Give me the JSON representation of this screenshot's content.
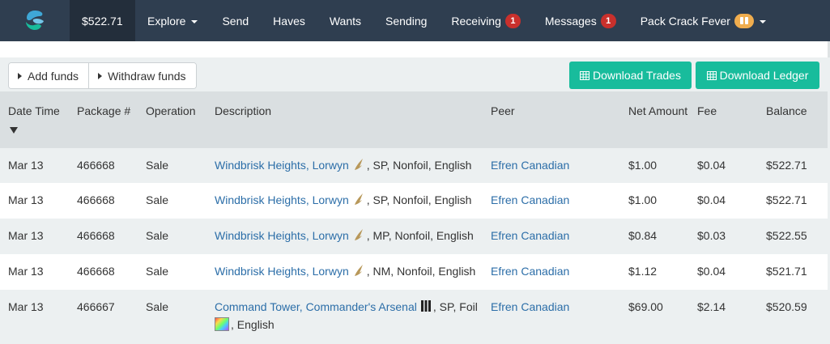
{
  "nav": {
    "balance": "$522.71",
    "items": [
      {
        "label": "Explore",
        "dropdown": true
      },
      {
        "label": "Send"
      },
      {
        "label": "Haves"
      },
      {
        "label": "Wants"
      },
      {
        "label": "Sending"
      },
      {
        "label": "Receiving",
        "badge": "1"
      },
      {
        "label": "Messages",
        "badge": "1"
      },
      {
        "label": "Pack Crack Fever",
        "dropdown": true
      }
    ]
  },
  "toolbar": {
    "add_funds": "Add funds",
    "withdraw_funds": "Withdraw funds",
    "download_trades": "Download Trades",
    "download_ledger": "Download Ledger"
  },
  "table": {
    "headers": {
      "date": "Date Time",
      "package": "Package #",
      "operation": "Operation",
      "description": "Description",
      "peer": "Peer",
      "net": "Net Amount",
      "fee": "Fee",
      "balance": "Balance"
    },
    "rows": [
      {
        "date": "Mar 13",
        "package": "466668",
        "operation": "Sale",
        "card": "Windbrisk Heights, Lorwyn",
        "details": ", SP, Nonfoil, English",
        "peer": "Efren Canadian",
        "net": "$1.00",
        "fee": "$0.04",
        "balance": "$522.71",
        "set_icon": "lorwyn-set-icon"
      },
      {
        "date": "Mar 13",
        "package": "466668",
        "operation": "Sale",
        "card": "Windbrisk Heights, Lorwyn",
        "details": ", SP, Nonfoil, English",
        "peer": "Efren Canadian",
        "net": "$1.00",
        "fee": "$0.04",
        "balance": "$522.71",
        "set_icon": "lorwyn-set-icon"
      },
      {
        "date": "Mar 13",
        "package": "466668",
        "operation": "Sale",
        "card": "Windbrisk Heights, Lorwyn",
        "details": ", MP, Nonfoil, English",
        "peer": "Efren Canadian",
        "net": "$0.84",
        "fee": "$0.03",
        "balance": "$522.55",
        "set_icon": "lorwyn-set-icon"
      },
      {
        "date": "Mar 13",
        "package": "466668",
        "operation": "Sale",
        "card": "Windbrisk Heights, Lorwyn",
        "details": ", NM, Nonfoil, English",
        "peer": "Efren Canadian",
        "net": "$1.12",
        "fee": "$0.04",
        "balance": "$521.71",
        "set_icon": "lorwyn-set-icon"
      },
      {
        "date": "Mar 13",
        "package": "466667",
        "operation": "Sale",
        "card": "Command Tower, Commander's Arsenal",
        "details": ", SP, Foil",
        "details2": ", English",
        "peer": "Efren Canadian",
        "net": "$69.00",
        "fee": "$2.14",
        "balance": "$520.59",
        "set_icon": "commanders-arsenal-set-icon",
        "foil_icon": "foil-icon"
      }
    ]
  },
  "colors": {
    "navbar": "#2f3e50",
    "accent_green": "#18bc9c",
    "badge_red": "#c9302c",
    "link_blue": "#2c6ea8"
  }
}
